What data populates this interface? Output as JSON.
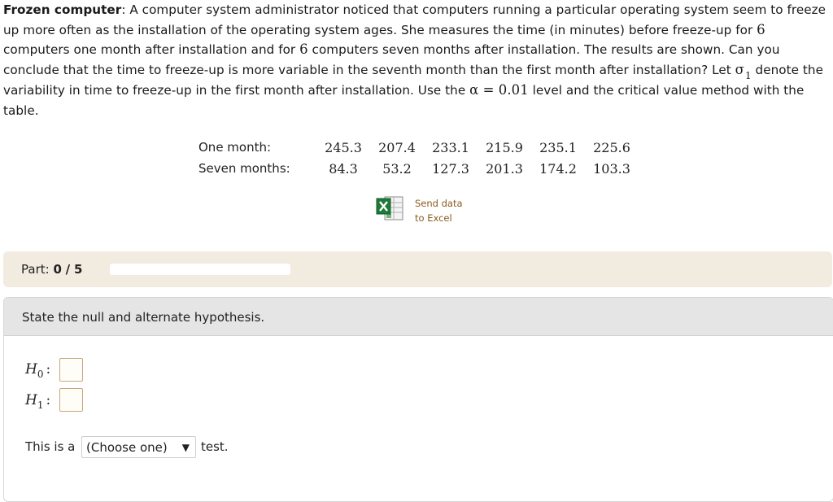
{
  "problem": {
    "title": "Frozen computer",
    "p1": ": A computer system administrator noticed that computers running a particular operating system seem to freeze up more often as the installation of the operating system ages. She measures the time (in minutes) before freeze-up for ",
    "n1": "6",
    "p2": " computers one month after installation and for ",
    "n2": "6",
    "p3": " computers seven months after installation. The results are shown. Can you conclude that the time to freeze-up is more variable in the seventh month than the first month after installation? Let ",
    "sigma": "σ",
    "sigma_sub": "1",
    "p4": " denote the variability in time to freeze-up in the first month after installation. Use the ",
    "alpha_expr": "α = 0.01",
    "p5": " level and the critical value method with the table."
  },
  "table": {
    "rows": [
      {
        "label": "One month:",
        "values": [
          "245.3",
          "207.4",
          "233.1",
          "215.9",
          "235.1",
          "225.6"
        ]
      },
      {
        "label": "Seven months:",
        "values": [
          "84.3",
          "53.2",
          "127.3",
          "201.3",
          "174.2",
          "103.3"
        ]
      }
    ]
  },
  "excel": {
    "line1": "Send data",
    "line2": "to Excel",
    "icon": "excel-icon"
  },
  "part": {
    "label": "Part:",
    "current": "0",
    "sep": "/",
    "total": "5",
    "progress": 0
  },
  "question": {
    "prompt": "State the null and alternate hypothesis.",
    "h0_letter": "H",
    "h0_sub": "0",
    "h1_letter": "H",
    "h1_sub": "1",
    "colon": ":",
    "test_prefix": "This is a",
    "select_value": "(Choose one)",
    "test_suffix": "test."
  }
}
